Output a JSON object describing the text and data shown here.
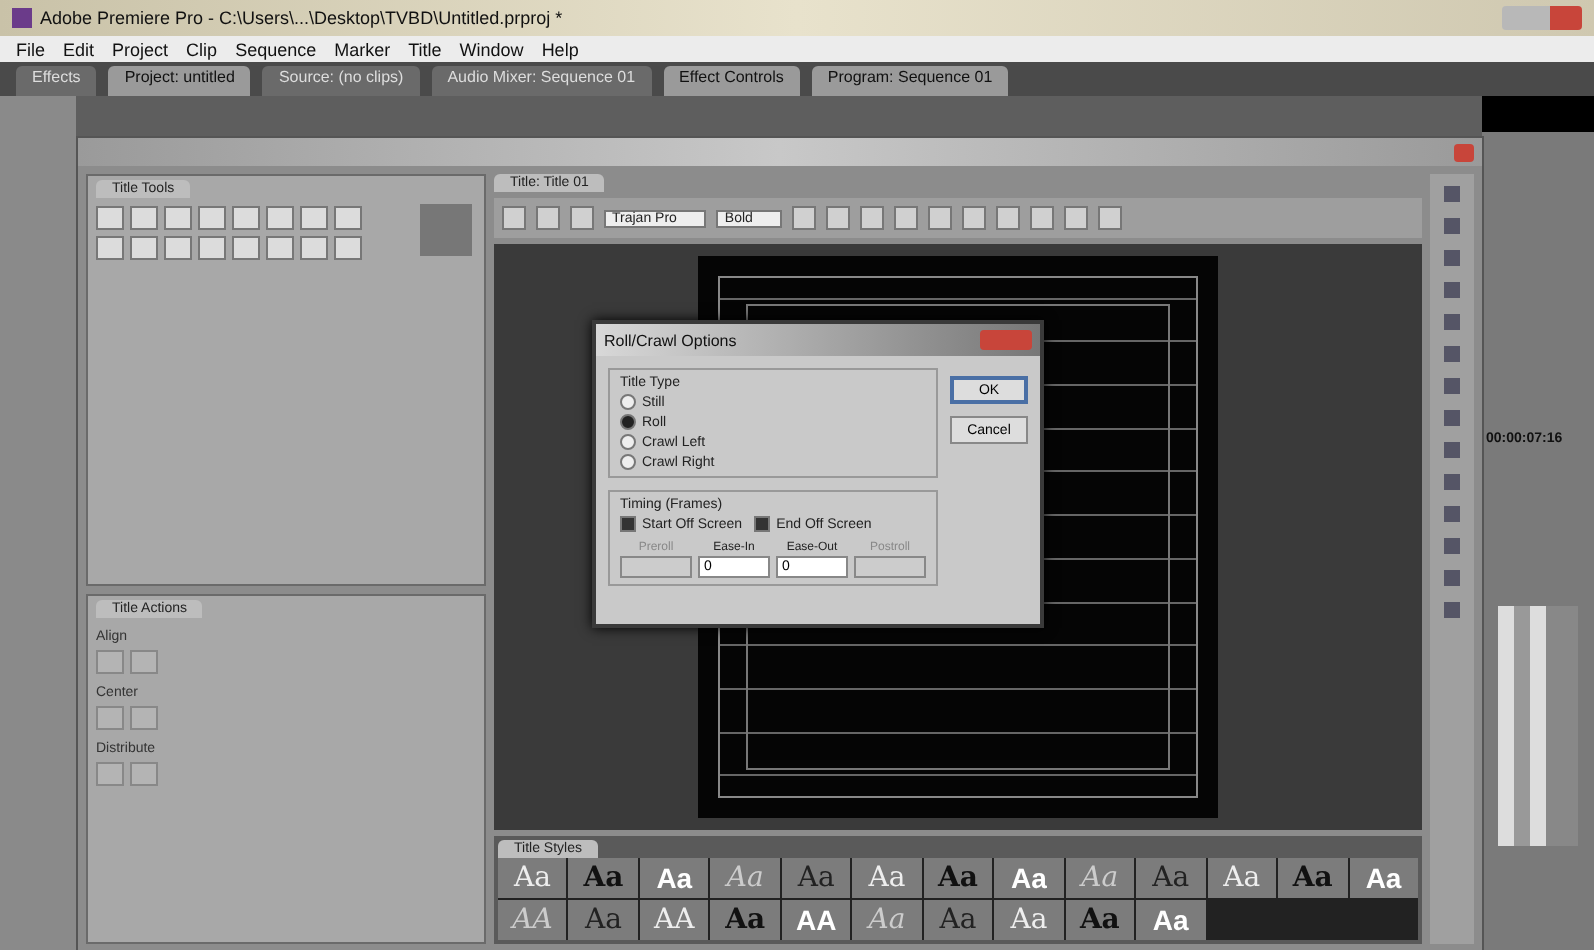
{
  "window": {
    "title": "Adobe Premiere Pro - C:\\Users\\...\\Desktop\\TVBD\\Untitled.prproj *"
  },
  "menu": [
    "File",
    "Edit",
    "Project",
    "Clip",
    "Sequence",
    "Marker",
    "Title",
    "Window",
    "Help"
  ],
  "panel_tabs": [
    {
      "label": "Effects",
      "selected": false
    },
    {
      "label": "Project: untitled",
      "selected": true
    },
    {
      "label": "Source: (no clips)",
      "selected": false
    },
    {
      "label": "Audio Mixer: Sequence 01",
      "selected": false
    },
    {
      "label": "Effect Controls",
      "selected": true
    },
    {
      "label": "Program: Sequence 01",
      "selected": true
    }
  ],
  "program": {
    "timecode": "00:00:07:16"
  },
  "title_designer": {
    "tools_panel": {
      "title": "Title Tools"
    },
    "actions_panel": {
      "title": "Title Actions",
      "sections": [
        "Align",
        "Center",
        "Distribute"
      ]
    },
    "main_tab": {
      "title": "Title: Title 01"
    },
    "toolbar": {
      "font": "Trajan Pro",
      "style": "Bold"
    },
    "styles_panel": {
      "title": "Title Styles",
      "samples": [
        "Aa",
        "Aa",
        "Aa",
        "Aa",
        "Aa",
        "Aa",
        "Aa",
        "Aa",
        "Aa",
        "Aa",
        "Aa",
        "Aa",
        "Aa",
        "AA",
        "Aa",
        "AA",
        "Aa",
        "AA",
        "Aa",
        "Aa",
        "Aa",
        "Aa",
        "Aa"
      ]
    }
  },
  "dialog": {
    "title": "Roll/Crawl Options",
    "title_type": {
      "label": "Title Type",
      "options": [
        {
          "label": "Still",
          "selected": false
        },
        {
          "label": "Roll",
          "selected": true
        },
        {
          "label": "Crawl Left",
          "selected": false
        },
        {
          "label": "Crawl Right",
          "selected": false
        }
      ]
    },
    "timing": {
      "label": "Timing (Frames)",
      "checks": [
        {
          "label": "Start Off Screen",
          "checked": true
        },
        {
          "label": "End Off Screen",
          "checked": true
        }
      ],
      "fields": [
        {
          "label": "Preroll",
          "disabled": true
        },
        {
          "label": "Ease-In",
          "value": "0",
          "disabled": false
        },
        {
          "label": "Ease-Out",
          "value": "0",
          "disabled": false
        },
        {
          "label": "Postroll",
          "disabled": true
        }
      ]
    },
    "buttons": [
      {
        "label": "OK",
        "kind": "default"
      },
      {
        "label": "Cancel",
        "kind": "normal"
      }
    ]
  }
}
